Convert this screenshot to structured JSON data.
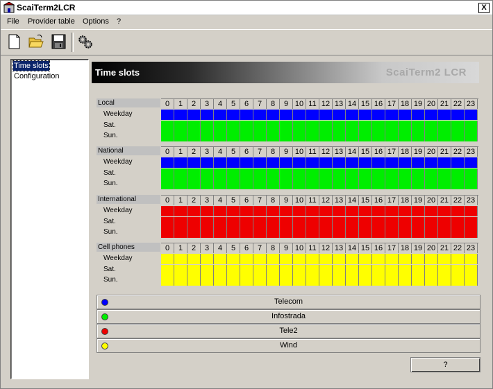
{
  "window": {
    "title": "ScaiTerm2LCR",
    "close_label": "X"
  },
  "menu": [
    "File",
    "Provider table",
    "Options",
    "?"
  ],
  "toolbar": {
    "icons": [
      "new-file-icon",
      "open-folder-icon",
      "save-disk-icon",
      "settings-gears-icon"
    ]
  },
  "tree": {
    "items": [
      {
        "label": "Time slots",
        "selected": true
      },
      {
        "label": "Configuration",
        "selected": false
      }
    ]
  },
  "header": {
    "title": "Time slots",
    "brand": "ScaiTerm2 LCR"
  },
  "hours": [
    "0",
    "1",
    "2",
    "3",
    "4",
    "5",
    "6",
    "7",
    "8",
    "9",
    "10",
    "11",
    "12",
    "13",
    "14",
    "15",
    "16",
    "17",
    "18",
    "19",
    "20",
    "21",
    "22",
    "23"
  ],
  "sections": [
    {
      "name": "Local",
      "rows": [
        "Weekday",
        "Sat.",
        "Sun."
      ],
      "weekday_color": "#0000ff",
      "weekend_color": "#00ee00"
    },
    {
      "name": "National",
      "rows": [
        "Weekday",
        "Sat.",
        "Sun."
      ],
      "weekday_color": "#0000ff",
      "weekend_color": "#00ee00"
    },
    {
      "name": "International",
      "rows": [
        "Weekday",
        "Sat.",
        "Sun."
      ],
      "weekday_color": "#ee0000",
      "weekend_color": "#ee0000"
    },
    {
      "name": "Cell phones",
      "rows": [
        "Weekday",
        "Sat.",
        "Sun."
      ],
      "weekday_color": "#ffff00",
      "weekend_color": "#ffff00"
    }
  ],
  "legend": [
    {
      "name": "Telecom",
      "color": "#0000ff"
    },
    {
      "name": "Infostrada",
      "color": "#00ee00"
    },
    {
      "name": "Tele2",
      "color": "#ee0000"
    },
    {
      "name": "Wind",
      "color": "#ffff00"
    }
  ],
  "help_button": "?"
}
